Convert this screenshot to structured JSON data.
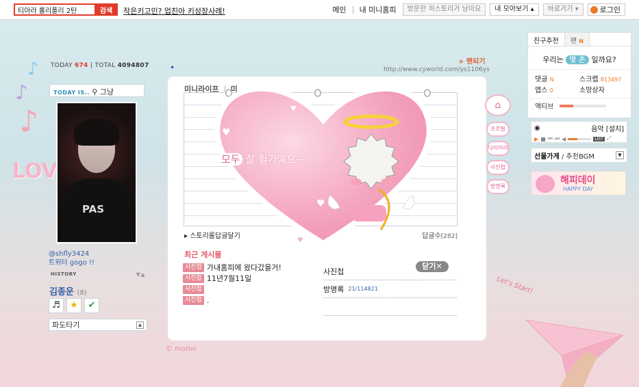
{
  "topbar": {
    "search_value": "티아라 롤리폴리 2탄",
    "search_button": "검색",
    "promo_link": "작은키고민? 업친아 키성장사례!",
    "nav_main": "메인",
    "nav_my_homepage": "내 미니홈피",
    "nav_history": "방문한 히스토리가 남아요",
    "nav_collection": "내 모아보기 ▴",
    "nav_shortcut": "바로가기 ▾",
    "nav_login": "로그인"
  },
  "left": {
    "today_label": "TODAY",
    "today_count": "674",
    "total_label": "TOTAL",
    "total_count": "4094807",
    "mood_label": "TODAY IS..",
    "mood_value": "그냥",
    "photo_shirt_text": "PAS",
    "profile_line1": "@shfly3424",
    "profile_line2": "트위터 gogo !!",
    "history_label": "HISTORY",
    "owner_name": "김종운",
    "owner_count": "(8)",
    "wave_label": "파도타기",
    "love_text": "LOVE"
  },
  "main": {
    "fan_link": "팬되기",
    "url": "http://www.cyworld.com/ys1106ys",
    "tab_minilife": "미니라이프",
    "tab_mini": "미",
    "story_link": "스토리룸답글달기",
    "story_link_2": "",
    "reply_label": "답글수",
    "reply_count": "[282]",
    "recent_title": "최근 게시물",
    "recent_items": [
      {
        "badge": "사진첩",
        "text": "가내홈피에 왔다갔을거!"
      },
      {
        "badge": "사진첩",
        "text": "11년7월11일"
      },
      {
        "badge": "사진첩",
        "text": ""
      },
      {
        "badge": "사진첩",
        "text": "."
      }
    ],
    "right_items": [
      {
        "label": "사진첩",
        "sub": ""
      },
      {
        "label": "방명록",
        "sub": "21/114821"
      },
      {
        "label": "",
        "sub": ""
      }
    ],
    "close_button": "닫기✕",
    "heart_everyone": "모두",
    "heart_message": "잘 될거예요~",
    "copyright": "© momo"
  },
  "side_menu": [
    "프로필",
    "다이어리",
    "사진첩",
    "방명록"
  ],
  "right": {
    "tab_friends": "친구추천",
    "tab_fans": "팬",
    "friend_question_pre": "우리는",
    "friend_question_pill": "몇 촌",
    "friend_question_post": "일까요?",
    "stat_comments": "댓글",
    "stat_scrap": "스크랩",
    "stat_scrap_count": "813497",
    "stat_apps": "앱스",
    "stat_gift": "소망상자",
    "active_label": "액티브",
    "active_level": 0.3,
    "music_label": "음악",
    "music_install": "[설치]",
    "music_list": "LIST",
    "music_volume": 0.4,
    "bgm_bold": "선물가게",
    "bgm_rest": " / 추천BGM",
    "banner_text": "해피데이",
    "banner_sub": "HAPPY DAY"
  },
  "deco": {
    "lets_start": "Let's Start!"
  }
}
